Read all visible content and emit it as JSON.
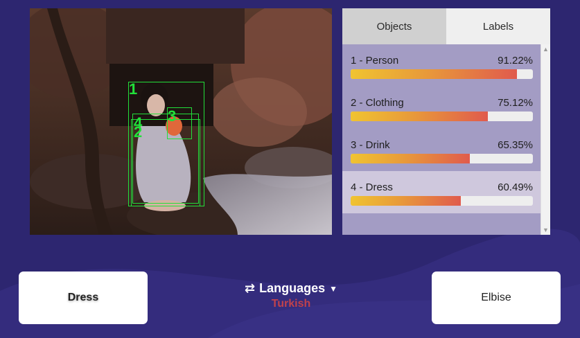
{
  "tabs": [
    {
      "label": "Objects",
      "active": true
    },
    {
      "label": "Labels",
      "active": false
    }
  ],
  "detections": [
    {
      "label": "1 - Person",
      "score": "91.22%",
      "fraction": 0.9122,
      "selected": false
    },
    {
      "label": "2 - Clothing",
      "score": "75.12%",
      "fraction": 0.7512,
      "selected": false
    },
    {
      "label": "3 - Drink",
      "score": "65.35%",
      "fraction": 0.6535,
      "selected": false
    },
    {
      "label": "4 - Dress",
      "score": "60.49%",
      "fraction": 0.6049,
      "selected": true
    }
  ],
  "box_numbers": [
    "1",
    "2",
    "3",
    "4"
  ],
  "source_word": "Dress",
  "translated_word": "Elbise",
  "languages": {
    "button_label": "Languages",
    "selected": "Turkish"
  },
  "colors": {
    "background": "#2d2670",
    "box_green": "#22e03a",
    "selected_language": "#c0424c"
  }
}
